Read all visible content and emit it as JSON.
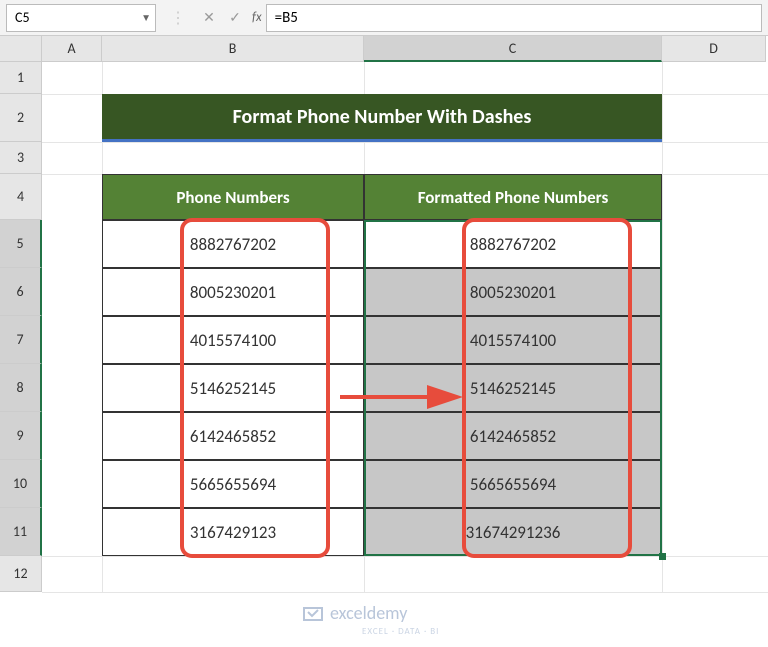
{
  "name_box": "C5",
  "formula": "=B5",
  "fx_label": "fx",
  "columns": [
    "A",
    "B",
    "C",
    "D"
  ],
  "rows": [
    "1",
    "2",
    "3",
    "4",
    "5",
    "6",
    "7",
    "8",
    "9",
    "10",
    "11",
    "12"
  ],
  "title": "Format Phone Number With Dashes",
  "headers": {
    "b": "Phone Numbers",
    "c": "Formatted Phone Numbers"
  },
  "data": [
    {
      "b": "8882767202",
      "c": "8882767202"
    },
    {
      "b": "8005230201",
      "c": "8005230201"
    },
    {
      "b": "4015574100",
      "c": "4015574100"
    },
    {
      "b": "5146252145",
      "c": "5146252145"
    },
    {
      "b": "6142465852",
      "c": "6142465852"
    },
    {
      "b": "5665655694",
      "c": "5665655694"
    },
    {
      "b": "3167429123",
      "c": "31674291236"
    }
  ],
  "watermark": {
    "brand": "exceldemy",
    "tag": "EXCEL · DATA · BI"
  }
}
